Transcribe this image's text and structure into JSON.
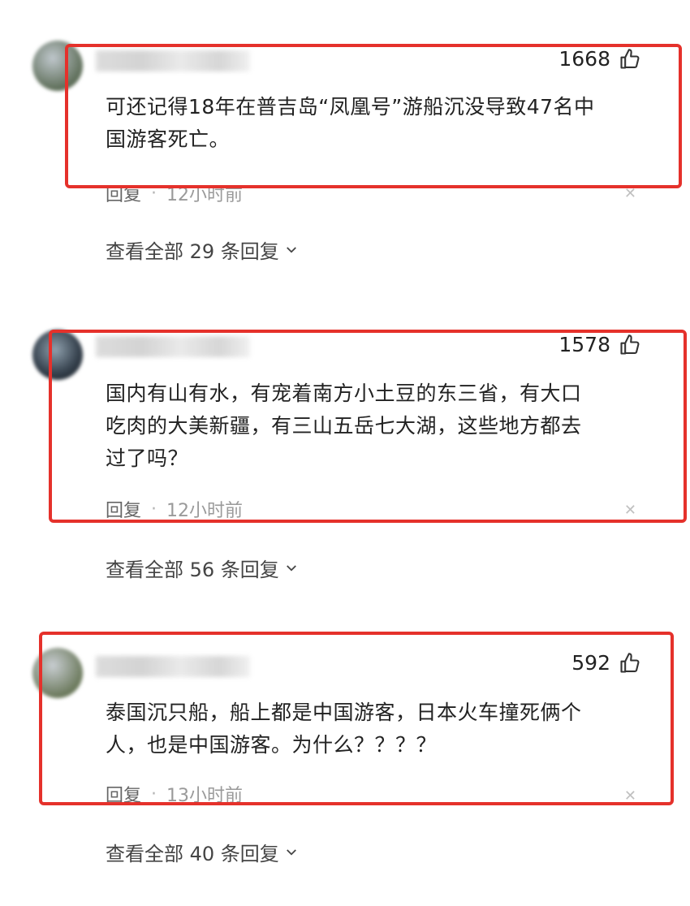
{
  "comments": [
    {
      "likes": "1668",
      "text_lines": [
        "可还记得18年在普吉岛“凤凰号”游船沉没导致47名中",
        "国游客死亡。"
      ],
      "reply_label": "回复",
      "time": "12小时前",
      "view_all": "查看全部 29 条回复"
    },
    {
      "likes": "1578",
      "text_lines": [
        "国内有山有水，有宠着南方小土豆的东三省，有大口",
        "吃肉的大美新疆，有三山五岳七大湖，这些地方都去",
        "过了吗？"
      ],
      "reply_label": "回复",
      "time": "12小时前",
      "view_all": "查看全部 56 条回复"
    },
    {
      "likes": "592",
      "text_lines": [
        "泰国沉只船，船上都是中国游客，日本火车撞死俩个",
        "人，也是中国游客。为什么？？？？"
      ],
      "reply_label": "回复",
      "time": "13小时前",
      "view_all": "查看全部 40 条回复"
    }
  ],
  "icons": {
    "like": "thumbs-up-icon",
    "close": "close-icon",
    "expand": "chevron-down-icon"
  },
  "colors": {
    "highlight_box": "#e5312b",
    "text": "#222222",
    "meta": "#9a9a9a"
  }
}
